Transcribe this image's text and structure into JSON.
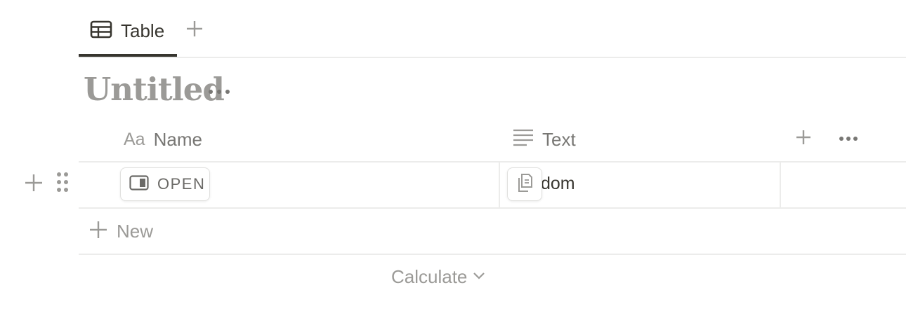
{
  "tabs": [
    {
      "label": "Table",
      "icon": "table-icon",
      "active": true
    }
  ],
  "add_view_icon": "plus-icon",
  "database_title": "Untitled",
  "title_more_icon": "more-horizontal-icon",
  "columns": [
    {
      "label": "Name",
      "type_label": "Aa",
      "icon": "title-type-icon"
    },
    {
      "label": "Text",
      "icon": "text-type-icon"
    }
  ],
  "header_actions": {
    "add_column_icon": "plus-icon",
    "more_icon": "more-horizontal-icon"
  },
  "rows": [
    {
      "name": "",
      "open_label": "OPEN",
      "text": "dom"
    }
  ],
  "new_row_label": "New",
  "calculate_label": "Calculate",
  "colors": {
    "text": "#37352f",
    "muted": "#9b9a97",
    "border": "#ececeb"
  }
}
